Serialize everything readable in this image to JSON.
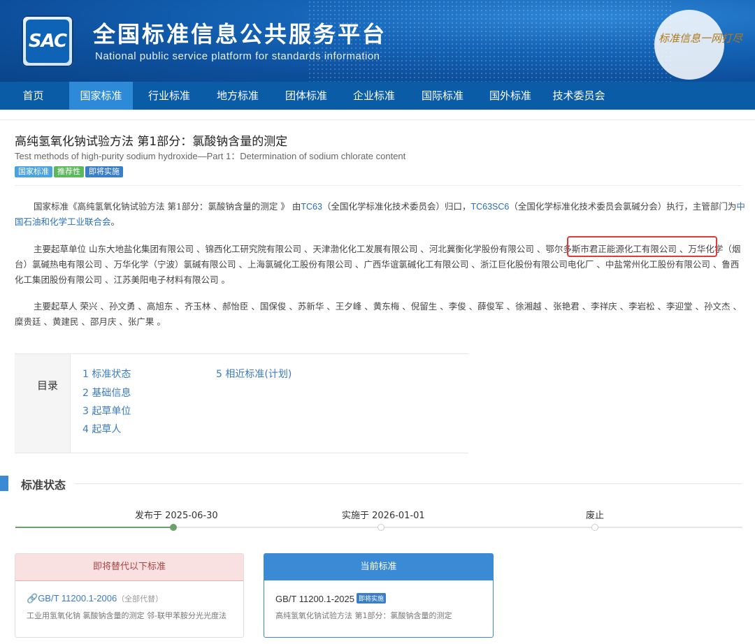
{
  "header": {
    "logo_text": "SAC",
    "site_title_cn": "全国标准信息公共服务平台",
    "site_title_en": "National public service platform  for standards information",
    "slogan": "标准信息一网打尽"
  },
  "nav": {
    "items": [
      "首页",
      "国家标准",
      "行业标准",
      "地方标准",
      "团体标准",
      "企业标准",
      "国际标准",
      "国外标准",
      "技术委员会"
    ],
    "active": "国家标准"
  },
  "standard": {
    "title_cn": "高纯氢氧化钠试验方法 第1部分：氯酸钠含量的测定",
    "title_en": "Test methods of high-purity sodium hydroxide—Part 1：Determination of sodium chlorate content",
    "tags": [
      {
        "label": "国家标准",
        "color": "#4aa3df"
      },
      {
        "label": "推荐性",
        "color": "#5cb85c"
      },
      {
        "label": "即将实施",
        "color": "#3a7ec8"
      }
    ]
  },
  "intro": {
    "p1_a": "国家标准《高纯氢氧化钠试验方法 第1部分：氯酸钠含量的测定 》 由",
    "p1_link1": "TC63",
    "p1_b": "（全国化学标准化技术委员会）归口，",
    "p1_link2": "TC63SC6",
    "p1_c": "（全国化学标准化技术委员会氯碱分会）执行，主管部门为",
    "p1_link3": "中国石油和化学工业联合会",
    "p1_d": "。",
    "p2": "主要起草单位 山东大地盐化集团有限公司 、锦西化工研究院有限公司 、天津渤化化工发展有限公司 、河北冀衡化学股份有限公司 、鄂尔多斯市君正能源化工有限公司 、万华化学（烟台）氯碱热电有限公司 、万华化学（宁波）氯碱有限公司 、上海氯碱化工股份有限公司 、广西华谊氯碱化工有限公司 、浙江巨化股份有限公司电化厂 、中盐常州化工股份有限公司 、鲁西化工集团股份有限公司 、江苏美阳电子材料有限公司 。",
    "p3": "主要起草人 荣兴 、孙文勇 、高旭东 、齐玉林 、郝怡臣 、国保俊 、苏新华 、王夕峰 、黄东梅 、倪留生 、李俊 、薛俊军 、徐湘越 、张艳君 、李祥庆 、李岩松 、李迎堂 、孙文杰 、糜贵廷 、黄建民 、邵月庆 、张广果 。"
  },
  "toc": {
    "label": "目录",
    "items": [
      "1  标准状态",
      "2  基础信息",
      "3  起草单位",
      "4  起草人",
      "5  相近标准(计划)"
    ]
  },
  "status": {
    "section_title": "标准状态",
    "published": "发布于 2025-06-30",
    "implemented": "实施于 2026-01-01",
    "abolished": "废止",
    "progress": 0.22
  },
  "replaced_box": {
    "header": "即将替代以下标准",
    "code": "GB/T 11200.1-2006",
    "note": "（全部代替）",
    "desc": "工业用氢氧化钠 氯酸钠含量的测定 邻-联甲苯胺分光光度法"
  },
  "current_box": {
    "header": "当前标准",
    "code": "GB/T 11200.1-2025",
    "badge": "即将实施",
    "desc": "高纯氢氧化钠试验方法 第1部分：氯酸钠含量的测定"
  }
}
